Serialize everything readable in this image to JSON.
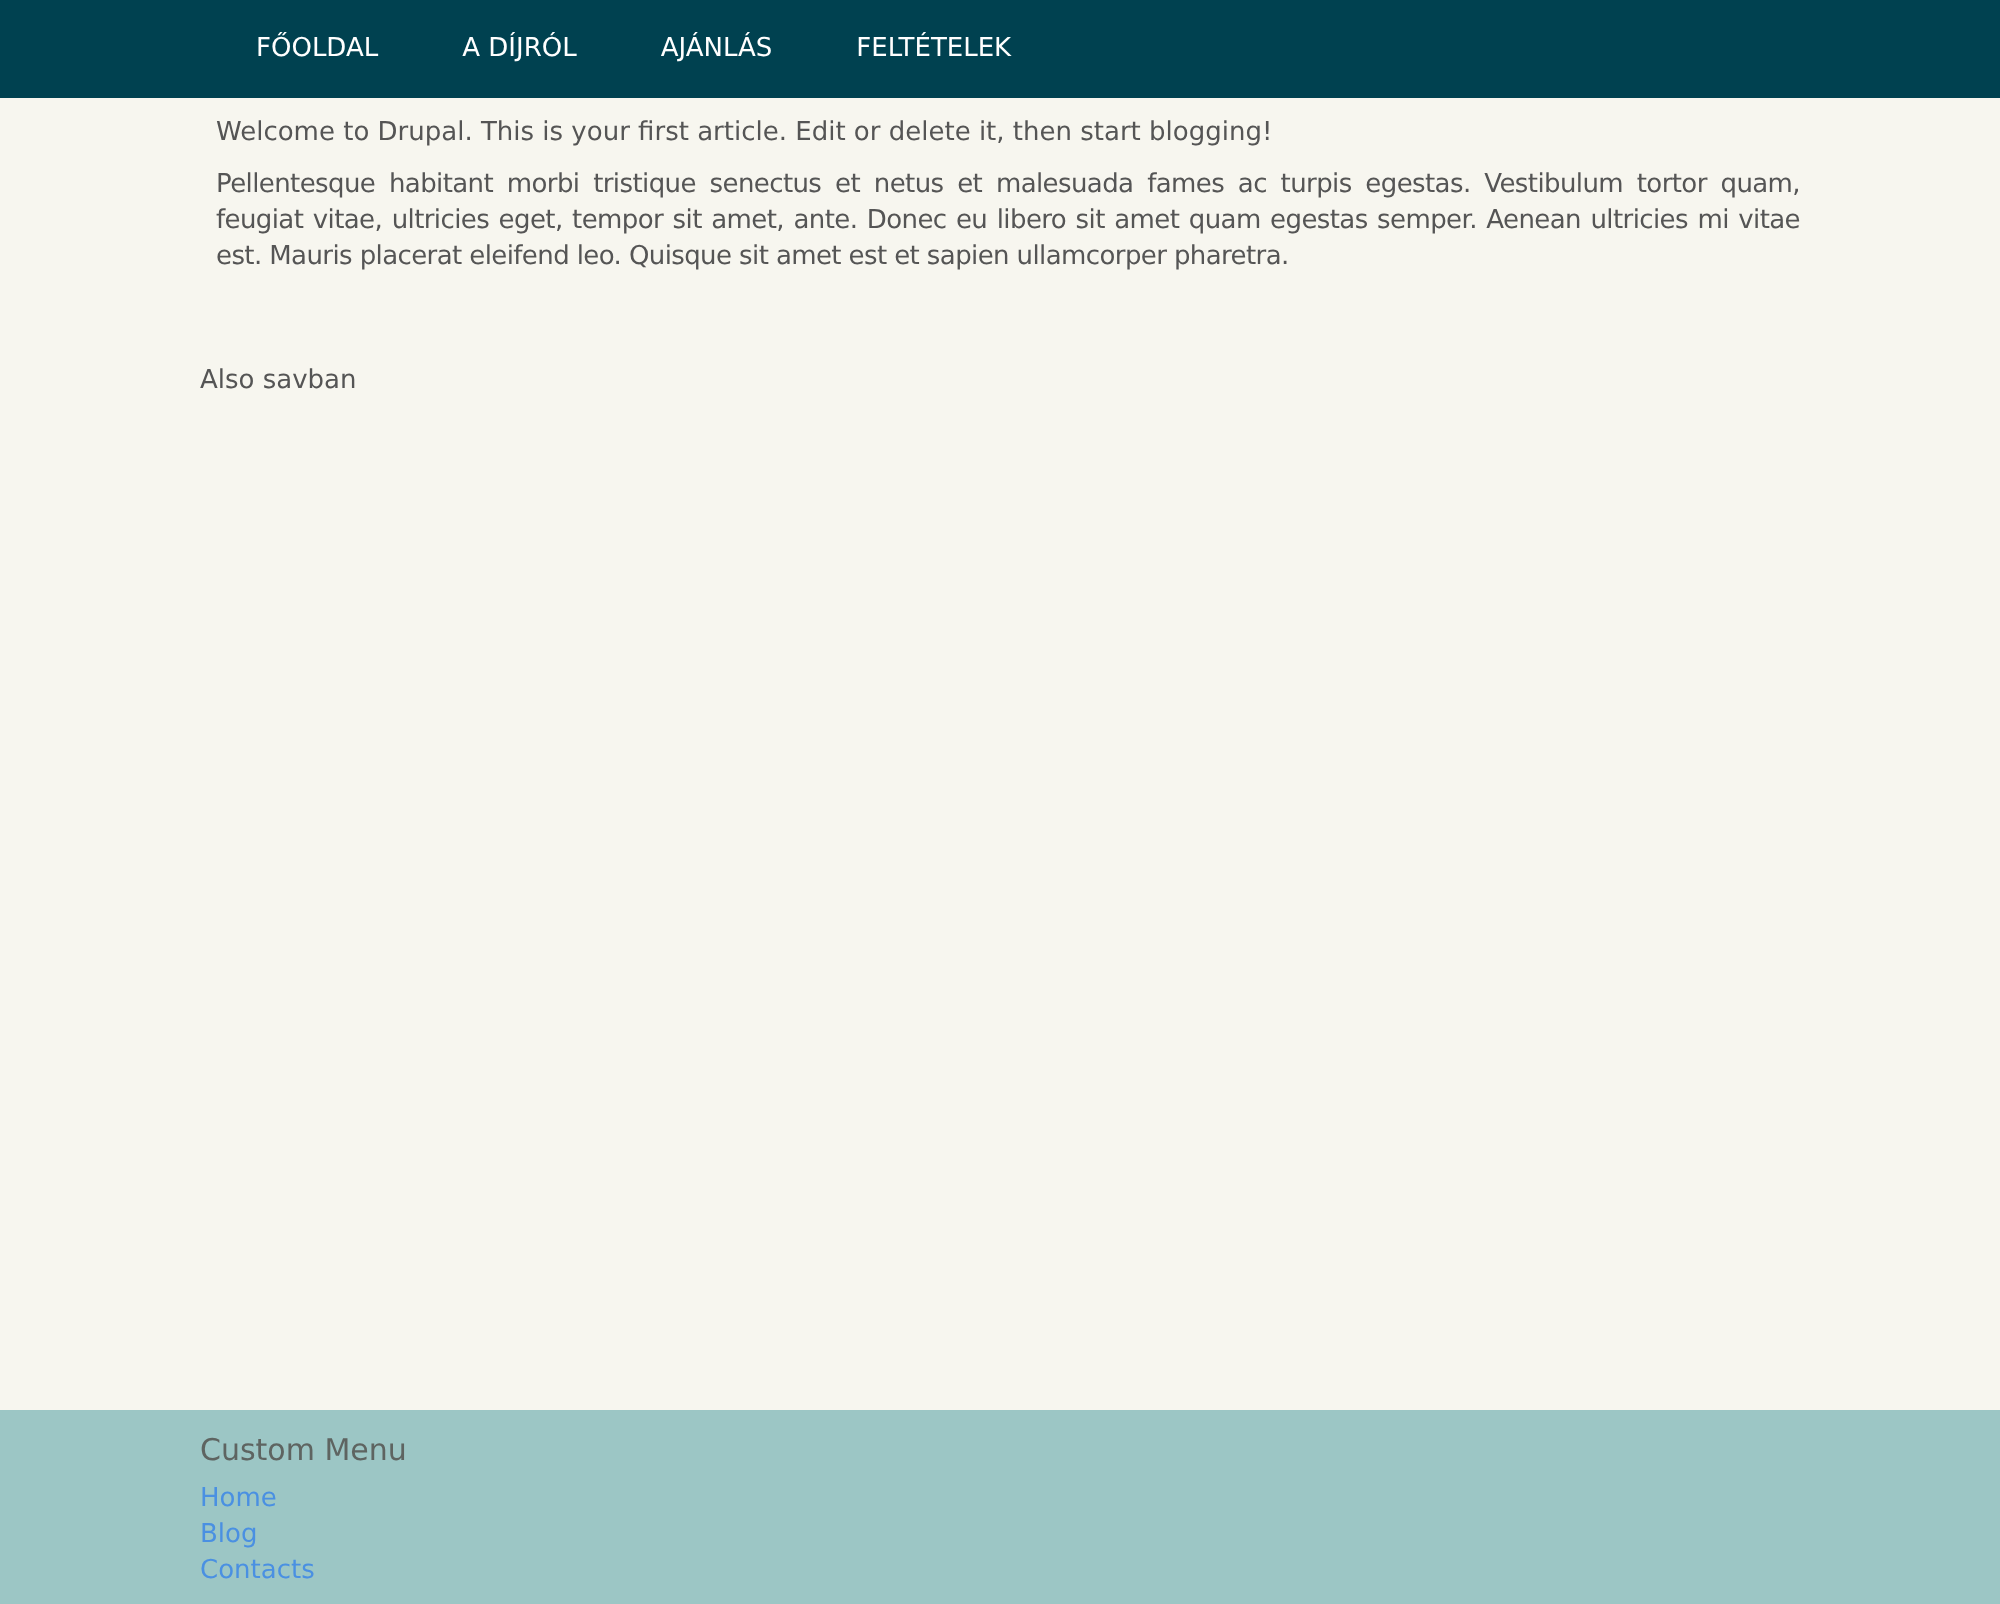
{
  "nav": {
    "items": [
      {
        "label": "FŐOLDAL"
      },
      {
        "label": "A DÍJRÓL"
      },
      {
        "label": "AJÁNLÁS"
      },
      {
        "label": "FELTÉTELEK"
      }
    ]
  },
  "article": {
    "intro": "Welcome to Drupal. This is your first article. Edit or delete it, then start blogging!",
    "body": "Pellentesque habitant morbi tristique senectus et netus et malesuada fames ac turpis egestas. Vestibulum tortor quam, feugiat vitae, ultricies eget, tempor sit amet, ante. Donec eu libero sit amet quam egestas semper. Aenean ultricies mi vitae est. Mauris placerat eleifend leo. Quisque sit amet est et sapien ullamcorper pharetra."
  },
  "lower_text": "Also savban",
  "footer": {
    "title": "Custom Menu",
    "links": [
      "Home",
      "Blog",
      "Contacts"
    ]
  }
}
